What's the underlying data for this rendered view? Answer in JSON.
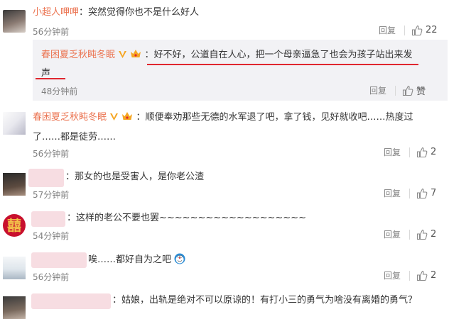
{
  "comments": [
    {
      "username": "小超人呷呷",
      "text": "：突然觉得你也不是什么好人",
      "time": "56分钟前",
      "reply_label": "回复",
      "likes": "22"
    },
    {
      "username": "春困夏乏秋盹冬眠",
      "text_line1": "：好不好，公道自在人心，把一个母亲逼急了也会为孩子站出来发",
      "text_line2": "声",
      "time": "48分钟前",
      "reply_label": "回复",
      "likes": "赞"
    },
    {
      "username": "春困夏乏秋盹冬眠",
      "text_line1": "：顺便奉劝那些无德的水军退了吧，拿了钱，见好就收吧……热度过",
      "text_line2": "了……都是徒劳……",
      "time": "56分钟前",
      "reply_label": "回复",
      "likes": "2"
    },
    {
      "text": "：那女的也是受害人，是你老公渣",
      "time": "57分钟前",
      "reply_label": "回复",
      "likes": "7"
    },
    {
      "text": "：这样的老公不要也罢~~~~~~~~~~~~~~~~~~~",
      "time": "54分钟前",
      "reply_label": "回复",
      "likes": "2"
    },
    {
      "text": "唉……都好自为之吧",
      "time": "56分钟前",
      "reply_label": "回复",
      "likes": "2"
    },
    {
      "text": "：姑娘，出轨是绝对不可以原谅的！有打小三的勇气为啥没有离婚的勇气？"
    }
  ],
  "avatar_glyph": "囍",
  "colors": {
    "username": "#eb7350",
    "underline": "#e0262f",
    "quote_bg": "#f2f2f5",
    "meta": "#808080"
  }
}
